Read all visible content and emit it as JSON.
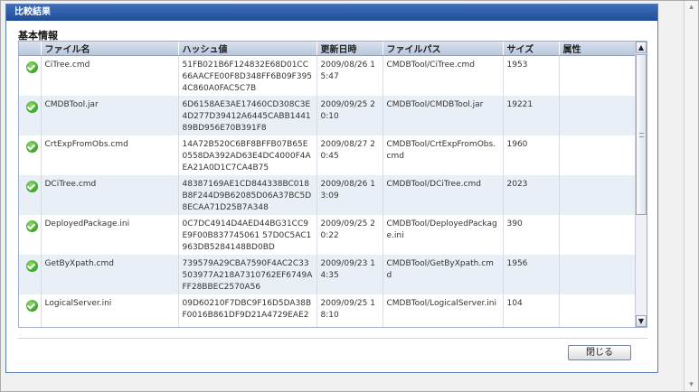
{
  "dialog": {
    "title": "比較結果"
  },
  "section": {
    "title": "基本情報"
  },
  "table": {
    "headers": [
      "",
      "ファイル名",
      "ハッシュ値",
      "更新日時",
      "ファイルパス",
      "サイズ",
      "属性"
    ],
    "rows": [
      {
        "status_icon": "check-icon",
        "name": "CiTree.cmd",
        "hash": "51FB021B6F124832E68D01CC66AACFE00F8D348FF6B09F3954C860A0FAC5C7B",
        "date": "2009/08/26 15:47",
        "path": "CMDBTool/CiTree.cmd",
        "size": "1953",
        "attr": ""
      },
      {
        "status_icon": "check-icon",
        "name": "CMDBTool.jar",
        "hash": "6D6158AE3AE17460CD308C3E4D277D39412A6445CABB144189BD956E70B391F8",
        "date": "2009/09/25 20:10",
        "path": "CMDBTool/CMDBTool.jar",
        "size": "19221",
        "attr": ""
      },
      {
        "status_icon": "check-icon",
        "name": "CrtExpFromObs.cmd",
        "hash": "14A72B520C6BF8BFFB07B65E0558DA392AD63E4DC4000F4AEA21A0D1C7CA4B75",
        "date": "2009/08/27 20:45",
        "path": "CMDBTool/CrtExpFromObs.cmd",
        "size": "1960",
        "attr": ""
      },
      {
        "status_icon": "check-icon",
        "name": "DCiTree.cmd",
        "hash": "48387169AE1CD844338BC018B8F244D9B62085D06A37BC5D8ECAA71D25B7A348",
        "date": "2009/08/26 13:09",
        "path": "CMDBTool/DCiTree.cmd",
        "size": "2023",
        "attr": ""
      },
      {
        "status_icon": "check-icon",
        "name": "DeployedPackage.ini",
        "hash": "0C7DC4914D4AED44BG31CC9E9F00B837745061 57D0C5AC1963DB5284148BD0BD",
        "date": "2009/09/25 20:22",
        "path": "CMDBTool/DeployedPackage.ini",
        "size": "390",
        "attr": ""
      },
      {
        "status_icon": "check-icon",
        "name": "GetByXpath.cmd",
        "hash": "739579A29CBA7590F4AC2C33503977A218A7310762EF6749AFF28BBEC2570A56",
        "date": "2009/09/23 14:35",
        "path": "CMDBTool/GetByXpath.cmd",
        "size": "1956",
        "attr": ""
      },
      {
        "status_icon": "check-icon",
        "name": "LogicalServer.ini",
        "hash": "09D60210F7DBC9F16D5DA38BF0016B861DF9D21A4729EAE2",
        "date": "2009/09/25 18:10",
        "path": "CMDBTool/LogicalServer.ini",
        "size": "104",
        "attr": ""
      }
    ]
  },
  "footer": {
    "close_label": "閉じる"
  }
}
